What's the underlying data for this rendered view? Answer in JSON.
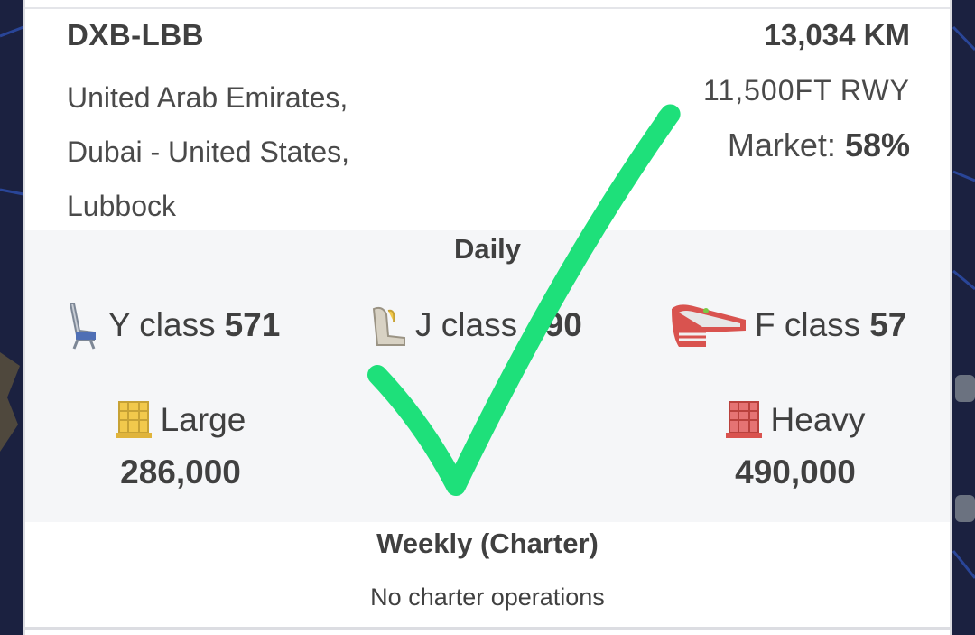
{
  "route": {
    "code": "DXB-LBB",
    "description": "United Arab Emirates, Dubai - United States, Lubbock",
    "distance": "13,034 KM",
    "runway": "11,500FT RWY",
    "market_label": "Market:",
    "market_value": "58%"
  },
  "daily": {
    "title": "Daily",
    "seats": [
      {
        "label": "Y class",
        "value": "571",
        "icon": "economy-seat-icon"
      },
      {
        "label": "J class",
        "value": "490",
        "icon": "business-seat-icon"
      },
      {
        "label": "F class",
        "value": "57",
        "icon": "first-class-seat-icon"
      }
    ],
    "cargo": [
      {
        "label": "Large",
        "value": "286,000",
        "icon": "large-cargo-icon",
        "color": "#f2c94c"
      },
      {
        "label": "Heavy",
        "value": "490,000",
        "icon": "heavy-cargo-icon",
        "color": "#d9534f"
      }
    ]
  },
  "weekly": {
    "title": "Weekly (Charter)",
    "note": "No charter operations"
  },
  "colors": {
    "checkmark": "#1ee07a",
    "panel_bg": "#f5f6f8",
    "text": "#404040"
  }
}
